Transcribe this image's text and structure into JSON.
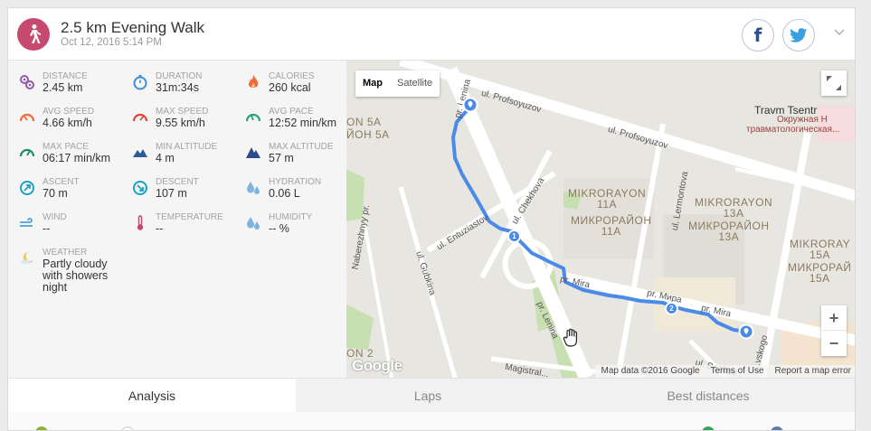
{
  "activity": {
    "title": "2.5 km Evening Walk",
    "datetime": "Oct 12, 2016 5:14 PM",
    "icon": "walk-icon",
    "color": "#c64a6f"
  },
  "social": {
    "facebook_label": "f"
  },
  "stats": [
    {
      "label": "DISTANCE",
      "value": "2.45 km",
      "icon": "distance-icon",
      "color": "#8e5ba8"
    },
    {
      "label": "DURATION",
      "value": "31m:34s",
      "icon": "stopwatch-icon",
      "color": "#3f8ed8"
    },
    {
      "label": "CALORIES",
      "value": "260 kcal",
      "icon": "flame-icon",
      "color": "#ef6a3a"
    },
    {
      "label": "AVG SPEED",
      "value": "4.66 km/h",
      "icon": "speedometer-icon",
      "color": "#ef6a3a"
    },
    {
      "label": "MAX SPEED",
      "value": "9.55 km/h",
      "icon": "speedometer-icon",
      "color": "#e0463a"
    },
    {
      "label": "AVG PACE",
      "value": "12:52 min/km",
      "icon": "pace-icon",
      "color": "#2aa07a"
    },
    {
      "label": "MAX PACE",
      "value": "06:17 min/km",
      "icon": "pace-icon",
      "color": "#1f8d6a"
    },
    {
      "label": "MIN ALTITUDE",
      "value": "4 m",
      "icon": "mountain-icon",
      "color": "#2a5d9a"
    },
    {
      "label": "MAX ALTITUDE",
      "value": "57 m",
      "icon": "mountain-icon",
      "color": "#2a4d8a"
    },
    {
      "label": "ASCENT",
      "value": "70 m",
      "icon": "ascent-icon",
      "color": "#18a3c4"
    },
    {
      "label": "DESCENT",
      "value": "107 m",
      "icon": "descent-icon",
      "color": "#18a3c4"
    },
    {
      "label": "HYDRATION",
      "value": "0.06 L",
      "icon": "drops-icon",
      "color": "#7fb3e0"
    },
    {
      "label": "WIND",
      "value": "--",
      "icon": "wind-icon",
      "color": "#4aa3d8"
    },
    {
      "label": "TEMPERATURE",
      "value": "--",
      "icon": "thermometer-icon",
      "color": "#c64a6f"
    },
    {
      "label": "HUMIDITY",
      "value": "-- %",
      "icon": "drops-icon",
      "color": "#7fb3e0"
    },
    {
      "label": "WEATHER",
      "value": "Partly cloudy with showers night",
      "icon": "weather-icon",
      "color": "#e8c85a"
    }
  ],
  "map": {
    "type_map": "Map",
    "type_satellite": "Satellite",
    "zoom_in": "+",
    "zoom_out": "−",
    "google": "Google",
    "attribution": [
      "Map data ©2016 Google",
      "Terms of Use",
      "Report a map error"
    ],
    "streets": [
      "ul. Profsoyuzov",
      "ul. Profsoyuzov",
      "pr. Lenina",
      "ul. Chekhova",
      "ul. Entuziastov",
      "ul. Lermontova",
      "ul. Gubkina",
      "Naberezhnyy pr.",
      "pr. Mira",
      "pr. Мира",
      "pr. Mira",
      "pr. Lenina",
      "Magistral...",
      "ul. Bazhov...",
      "...vskogo"
    ],
    "districts": [
      "MIKRORAYON\n11A",
      "МИКРОРАЙОН\n11A",
      "MIKRORAYON\n13A",
      "МИКРОРАЙОН\n13A",
      "MIKRORAY\n15A",
      "МИКРОРАЙ\n15A",
      "ON 5A",
      "ЙОН 5A",
      "ON 2"
    ],
    "poi": [
      "Travm Tsentr",
      "Окружная Н",
      "травматологическая..."
    ],
    "markers": [
      "1",
      "2"
    ]
  },
  "tabs": [
    {
      "label": "Analysis",
      "active": true
    },
    {
      "label": "Laps",
      "active": false
    },
    {
      "label": "Best distances",
      "active": false
    }
  ],
  "legend": [
    {
      "color": "#8bb33a"
    },
    {
      "color": "#ffffff"
    },
    {
      "color": "#3aa357"
    },
    {
      "color": "#5a7bb0"
    }
  ]
}
